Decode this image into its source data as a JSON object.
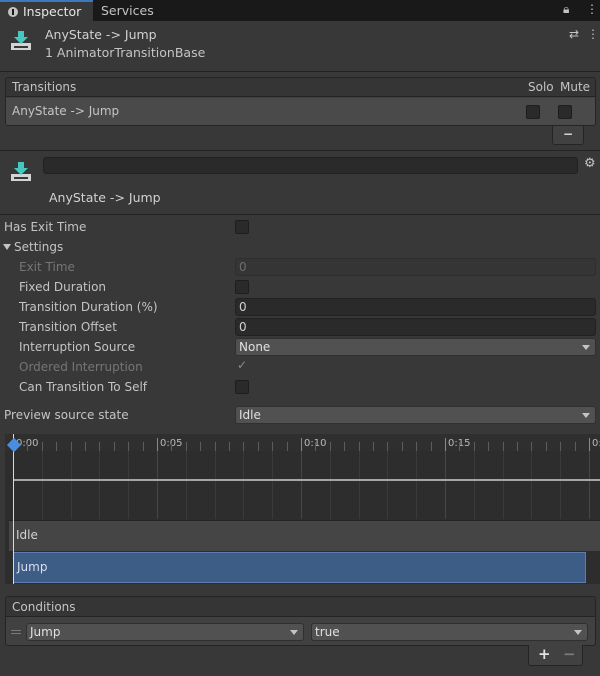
{
  "tabs": {
    "inspector": "Inspector",
    "services": "Services"
  },
  "header": {
    "title": "AnyState -> Jump",
    "subtitle": "1 AnimatorTransitionBase"
  },
  "transitions": {
    "header": "Transitions",
    "solo_label": "Solo",
    "mute_label": "Mute",
    "rows": [
      {
        "name": "AnyState -> Jump",
        "solo": false,
        "mute": false
      }
    ],
    "remove_label": "−"
  },
  "transition": {
    "name_value": "",
    "display_name": "AnyState -> Jump"
  },
  "settings": {
    "has_exit_time_label": "Has Exit Time",
    "settings_label": "Settings",
    "exit_time_label": "Exit Time",
    "exit_time_value": "0",
    "fixed_duration_label": "Fixed Duration",
    "transition_duration_label": "Transition Duration (%)",
    "transition_duration_value": "0",
    "transition_offset_label": "Transition Offset",
    "transition_offset_value": "0",
    "interruption_source_label": "Interruption Source",
    "interruption_source_value": "None",
    "ordered_interruption_label": "Ordered Interruption",
    "can_transition_to_self_label": "Can Transition To Self",
    "preview_source_state_label": "Preview source state",
    "preview_source_state_value": "Idle"
  },
  "timeline": {
    "ticks": [
      "0:00",
      "0:05",
      "0:10",
      "0:15",
      "0:"
    ],
    "source_state": "Idle",
    "dest_state": "Jump"
  },
  "conditions": {
    "header": "Conditions",
    "parameter": "Jump",
    "value": "true",
    "add_label": "+",
    "remove_label": "−"
  },
  "colors": {
    "accent": "#3a79bb",
    "jump_bar": "#3d5c86",
    "background": "#383838"
  }
}
